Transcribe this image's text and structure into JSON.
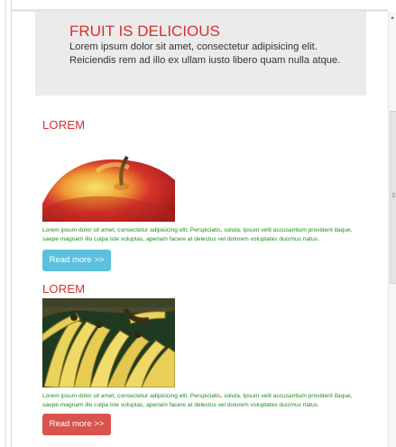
{
  "header": {
    "title": "FRUIT IS DELICIOUS",
    "text": "Lorem ipsum dolor sit amet, consectetur adipisicing elit. Reiciendis rem ad illo ex ullam iusto libero quam nulla atque."
  },
  "articles": [
    {
      "title": "LOREM",
      "image_icon": "apple-image",
      "description": "Lorem ipsum dolor sit amet, consectetur adipisicing elit. Perspiciatis, soluta. Ipsum velit accusantium provident itaque, saepe magnam illo culpa iste voluptas, aperiam facere at delectus vel dolorem voluptates ducimus natus.",
      "button_label": "Read more >>",
      "button_color": "#5bc0de"
    },
    {
      "title": "LOREM",
      "image_icon": "bananas-image",
      "description": "Lorem ipsum dolor sit amet, consectetur adipisicing elit. Perspiciatis, soluta. Ipsum velit accusantium provident itaque, saepe magnam illo culpa iste voluptas, aperiam facere at delectus vel dolorem voluptates ducimus natus.",
      "button_label": "Read more >>",
      "button_color": "#d9534f"
    }
  ],
  "colors": {
    "title_red": "#d8302d",
    "description_green": "#1f8a1f",
    "header_bg": "#ebebeb"
  }
}
